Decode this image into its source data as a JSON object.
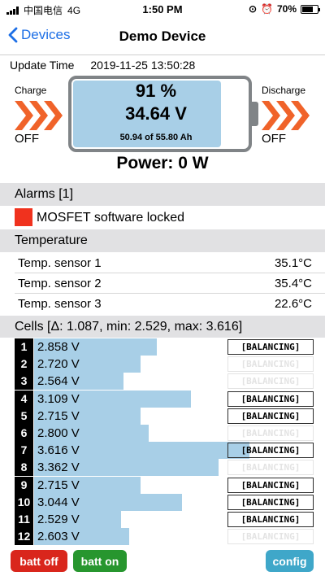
{
  "status_bar": {
    "carrier": "中国电信",
    "network": "4G",
    "time": "1:50 PM",
    "battery": "70%",
    "battery_level": 0.7
  },
  "nav": {
    "back_label": "Devices",
    "title": "Demo Device"
  },
  "summary": {
    "update_label": "Update Time",
    "update_time": "2019-11-25 13:50:28",
    "charge_label": "Charge",
    "charge_state": "OFF",
    "discharge_label": "Discharge",
    "discharge_state": "OFF",
    "soc": "91 %",
    "soc_level": 0.91,
    "voltage": "34.64 V",
    "capacity": "50.94 of 55.80 Ah",
    "power": "Power: 0 W"
  },
  "alarms": {
    "header": "Alarms [1]",
    "items": [
      "MOSFET software locked"
    ],
    "alarm_color": "#f0321e"
  },
  "temperature": {
    "header": "Temperature",
    "sensors": [
      {
        "label": "Temp. sensor 1",
        "value": "35.1°C"
      },
      {
        "label": "Temp. sensor 2",
        "value": "35.4°C"
      },
      {
        "label": "Temp. sensor 3",
        "value": "22.6°C"
      }
    ]
  },
  "cells": {
    "header": "Cells [Δ: 1.087, min: 2.529, max: 3.616]",
    "balancing_label": "[BALANCING]",
    "items": [
      {
        "num": "1",
        "voltage": "2.858 V",
        "level": 0.44,
        "balancing": true
      },
      {
        "num": "2",
        "voltage": "2.720 V",
        "level": 0.38,
        "balancing": false
      },
      {
        "num": "3",
        "voltage": "2.564 V",
        "level": 0.32,
        "balancing": false
      },
      {
        "num": "4",
        "voltage": "3.109 V",
        "level": 0.56,
        "balancing": true
      },
      {
        "num": "5",
        "voltage": "2.715 V",
        "level": 0.38,
        "balancing": true
      },
      {
        "num": "6",
        "voltage": "2.800 V",
        "level": 0.41,
        "balancing": false
      },
      {
        "num": "7",
        "voltage": "3.616 V",
        "level": 0.77,
        "balancing": true
      },
      {
        "num": "8",
        "voltage": "3.362 V",
        "level": 0.66,
        "balancing": false
      },
      {
        "num": "9",
        "voltage": "2.715 V",
        "level": 0.38,
        "balancing": true
      },
      {
        "num": "10",
        "voltage": "3.044 V",
        "level": 0.53,
        "balancing": true
      },
      {
        "num": "11",
        "voltage": "2.529 V",
        "level": 0.31,
        "balancing": true
      },
      {
        "num": "12",
        "voltage": "2.603 V",
        "level": 0.34,
        "balancing": false
      }
    ]
  },
  "buttons": {
    "batt_off": "batt off",
    "batt_on": "batt on",
    "config": "config",
    "batt_off_color": "#d9261c",
    "batt_on_color": "#27962e",
    "config_color": "#3fa7c9"
  },
  "colors": {
    "accent": "#1d6fe6",
    "arrow": "#f0632a",
    "bar": "#a8cfe7"
  }
}
